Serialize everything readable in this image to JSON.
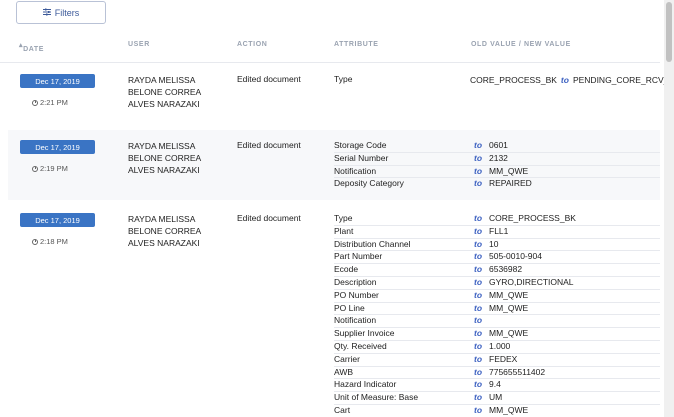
{
  "filters_label": "Filters",
  "columns": {
    "date": "DATE",
    "user": "USER",
    "action": "ACTION",
    "attribute": "ATTRIBUTE",
    "values": "OLD VALUE / NEW VALUE"
  },
  "to_word": "to",
  "entries": [
    {
      "date": "Dec 17, 2019",
      "time": "2:21 PM",
      "user": "RAYDA MELISSA BELONE CORREA ALVES NARAZAKI",
      "action": "Edited document",
      "changes": [
        {
          "attribute": "Type",
          "old": "CORE_PROCESS_BK",
          "new": "PENDING_CORE_RCV_BK"
        }
      ]
    },
    {
      "date": "Dec 17, 2019",
      "time": "2:19 PM",
      "user": "RAYDA MELISSA BELONE CORREA ALVES NARAZAKI",
      "action": "Edited document",
      "changes": [
        {
          "attribute": "Storage Code",
          "old": "",
          "new": "0601"
        },
        {
          "attribute": "Serial Number",
          "old": "",
          "new": "2132"
        },
        {
          "attribute": "Notification",
          "old": "",
          "new": "MM_QWE"
        },
        {
          "attribute": "Deposity Category",
          "old": "",
          "new": "REPAIRED"
        }
      ]
    },
    {
      "date": "Dec 17, 2019",
      "time": "2:18 PM",
      "user": "RAYDA MELISSA BELONE CORREA ALVES NARAZAKI",
      "action": "Edited document",
      "changes": [
        {
          "attribute": "Type",
          "old": "",
          "new": "CORE_PROCESS_BK"
        },
        {
          "attribute": "Plant",
          "old": "",
          "new": "FLL1"
        },
        {
          "attribute": "Distribution Channel",
          "old": "",
          "new": "10"
        },
        {
          "attribute": "Part Number",
          "old": "",
          "new": "505-0010-904"
        },
        {
          "attribute": "Ecode",
          "old": "",
          "new": "6536982"
        },
        {
          "attribute": "Description",
          "old": "",
          "new": "GYRO,DIRECTIONAL"
        },
        {
          "attribute": "PO Number",
          "old": "",
          "new": "MM_QWE"
        },
        {
          "attribute": "PO Line",
          "old": "",
          "new": "MM_QWE"
        },
        {
          "attribute": "Notification",
          "old": "",
          "new": ""
        },
        {
          "attribute": "Supplier Invoice",
          "old": "",
          "new": "MM_QWE"
        },
        {
          "attribute": "Qty. Received",
          "old": "",
          "new": "1.000"
        },
        {
          "attribute": "Carrier",
          "old": "",
          "new": "FEDEX"
        },
        {
          "attribute": "AWB",
          "old": "",
          "new": "775655511402"
        },
        {
          "attribute": "Hazard Indicator",
          "old": "",
          "new": "9.4"
        },
        {
          "attribute": "Unit of Measure: Base",
          "old": "",
          "new": "UM"
        },
        {
          "attribute": "Cart",
          "old": "",
          "new": "MM_QWE"
        }
      ]
    }
  ]
}
